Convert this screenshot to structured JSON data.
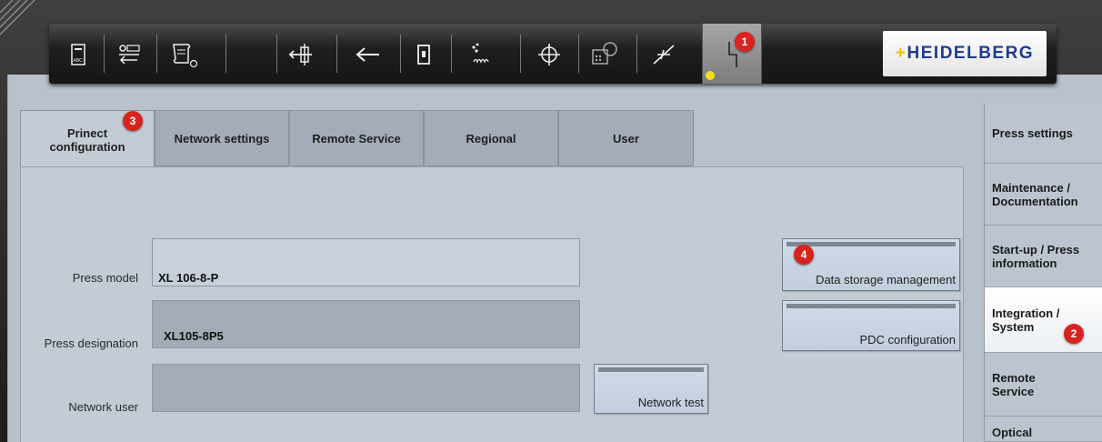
{
  "toolbar": {
    "tools": [
      {
        "icon": "abc-card-icon"
      },
      {
        "icon": "counter-arrow-icon"
      },
      {
        "icon": "document-clock-icon"
      },
      {
        "icon": "feeder-icon"
      },
      {
        "icon": "arrow-left-icon"
      },
      {
        "icon": "unit-icon"
      },
      {
        "icon": "powder-spray-icon"
      },
      {
        "icon": "register-crosshair-icon"
      },
      {
        "icon": "image-control-icon"
      },
      {
        "icon": "signal-icon"
      },
      {
        "icon": "power-lightning-icon"
      }
    ],
    "logo_text": "HEIDELBERG",
    "active_indicator_color": "#f3dc1d"
  },
  "tabs": [
    {
      "label": "Prinect configuration",
      "active": true
    },
    {
      "label": "Network settings",
      "active": false
    },
    {
      "label": "Remote Service",
      "active": false
    },
    {
      "label": "Regional",
      "active": false
    },
    {
      "label": "User",
      "active": false
    }
  ],
  "form": {
    "press_model": {
      "label": "Press model",
      "value": "XL 106-8-P"
    },
    "press_designation": {
      "label": "Press designation",
      "value": "XL105-8P5"
    },
    "network_user": {
      "label": "Network user",
      "value": ""
    }
  },
  "buttons": {
    "data_storage": "Data storage management",
    "pdc_config": "PDC configuration",
    "network_test": "Network test"
  },
  "sidebar": [
    {
      "label": "Press settings",
      "active": false
    },
    {
      "label": "Maintenance / Documentation",
      "active": false
    },
    {
      "label": "Start-up / Press information",
      "active": false
    },
    {
      "label": "Integration / System",
      "active": true
    },
    {
      "label": "Remote Service",
      "active": false
    },
    {
      "label": "Optical",
      "active": false
    }
  ],
  "markers": [
    "1",
    "2",
    "3",
    "4"
  ],
  "colors": {
    "marker": "#d8241e",
    "accent": "#1f3b8f",
    "logo_yellow": "#e8c300"
  }
}
